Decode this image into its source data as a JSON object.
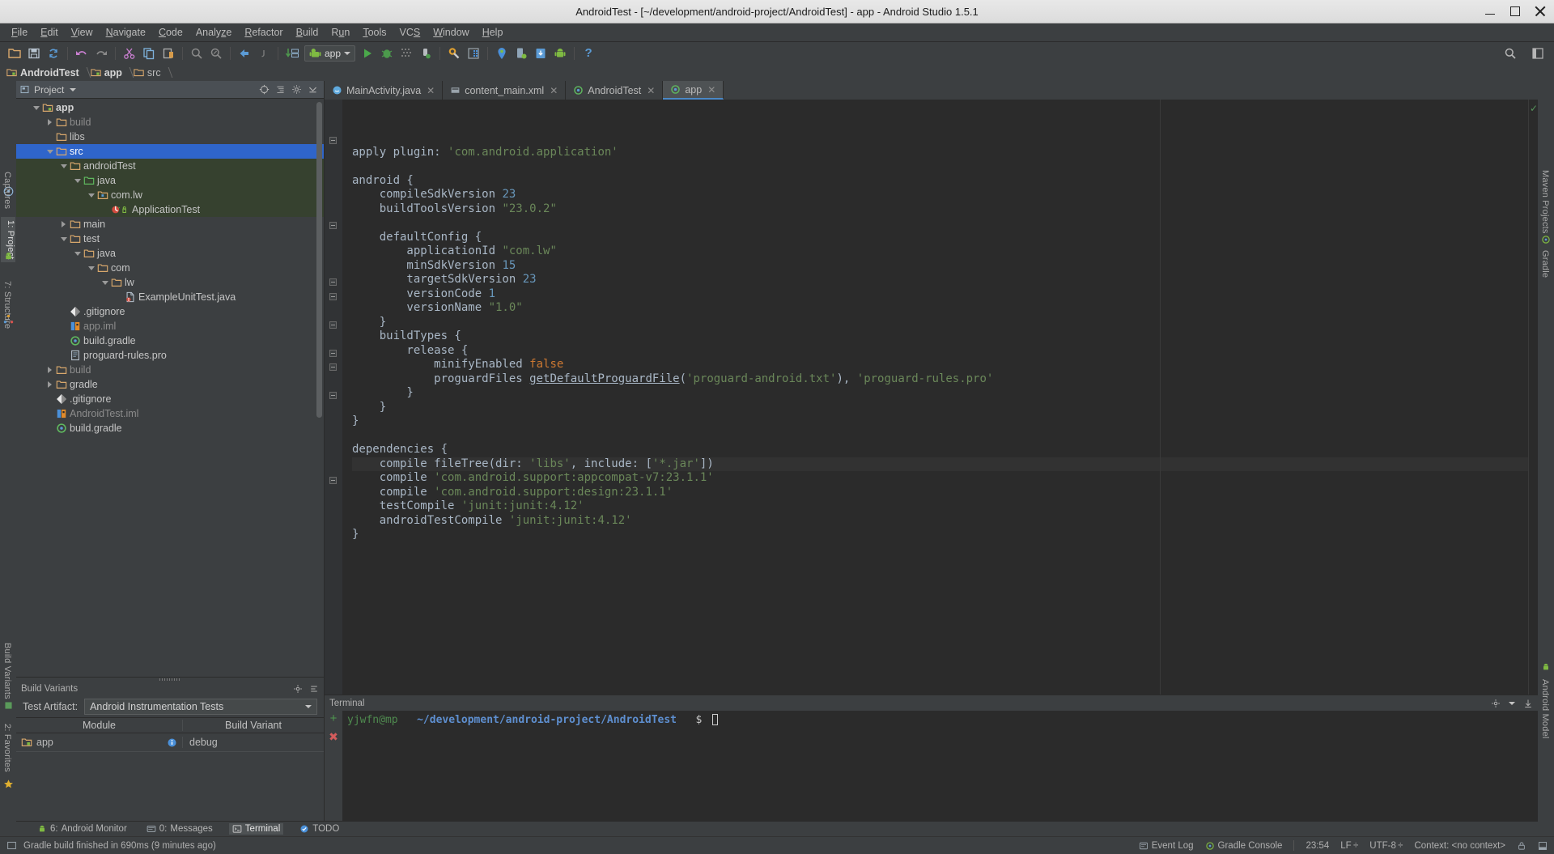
{
  "window": {
    "title": "AndroidTest - [~/development/android-project/AndroidTest] - app - Android Studio 1.5.1",
    "minimize": "minimize-window",
    "maximize": "maximize-window",
    "close": "close-window"
  },
  "menubar": [
    {
      "label": "File",
      "mnemonic": "F"
    },
    {
      "label": "Edit",
      "mnemonic": "E"
    },
    {
      "label": "View",
      "mnemonic": "V"
    },
    {
      "label": "Navigate",
      "mnemonic": "N"
    },
    {
      "label": "Code",
      "mnemonic": "C"
    },
    {
      "label": "Analyze",
      "mnemonic": "z"
    },
    {
      "label": "Refactor",
      "mnemonic": "R"
    },
    {
      "label": "Build",
      "mnemonic": "B"
    },
    {
      "label": "Run",
      "mnemonic": "R"
    },
    {
      "label": "Tools",
      "mnemonic": "T"
    },
    {
      "label": "VCS",
      "mnemonic": "S"
    },
    {
      "label": "Window",
      "mnemonic": "W"
    },
    {
      "label": "Help",
      "mnemonic": "H"
    }
  ],
  "toolbar": {
    "run_config_label": "app",
    "buttons": [
      "open-folder-icon",
      "save-all-icon",
      "sync-icon",
      "undo-icon",
      "redo-icon",
      "cut-icon",
      "copy-icon",
      "paste-icon",
      "find-icon",
      "find-usages-icon",
      "back-icon",
      "forward-icon",
      "update-project-icon"
    ],
    "right_buttons": [
      "search-everywhere-icon",
      "layout-icon"
    ]
  },
  "breadcrumb": [
    {
      "label": "AndroidTest",
      "icon": "module-icon",
      "bold": true
    },
    {
      "label": "app",
      "icon": "module-icon",
      "bold": true
    },
    {
      "label": "src",
      "icon": "folder-icon",
      "bold": false
    }
  ],
  "left_toolwindows": [
    {
      "label": "Captures",
      "icon": "captures-icon"
    },
    {
      "label": "1: Project",
      "icon": "android-icon",
      "selected": true
    },
    {
      "label": "7: Structure",
      "icon": "structure-icon"
    },
    {
      "label": "Build Variants",
      "icon": "variants-icon"
    },
    {
      "label": "2: Favorites",
      "icon": "favorites-icon"
    }
  ],
  "right_toolwindows": [
    {
      "label": "Maven Projects",
      "icon": "maven-icon"
    },
    {
      "label": "Gradle",
      "icon": "gradle-icon"
    },
    {
      "label": "Android Model",
      "icon": "android-model-icon"
    }
  ],
  "project_panel": {
    "title": "Project",
    "actions": [
      "target-icon",
      "collapse-all-icon",
      "settings-icon",
      "hide-icon"
    ],
    "tree": [
      {
        "depth": 0,
        "label": "app",
        "icon": "module",
        "twisty": "down",
        "bold": true
      },
      {
        "depth": 1,
        "label": "build",
        "icon": "folder",
        "twisty": "right",
        "dim": true
      },
      {
        "depth": 1,
        "label": "libs",
        "icon": "folder",
        "twisty": "none"
      },
      {
        "depth": 1,
        "label": "src",
        "icon": "folder",
        "twisty": "down",
        "selected": true
      },
      {
        "depth": 2,
        "label": "androidTest",
        "icon": "folder",
        "twisty": "down",
        "green": true
      },
      {
        "depth": 3,
        "label": "java",
        "icon": "folder-source",
        "twisty": "down",
        "green": true
      },
      {
        "depth": 4,
        "label": "com.lw",
        "icon": "package",
        "twisty": "down",
        "green": true
      },
      {
        "depth": 5,
        "label": "ApplicationTest",
        "icon": "class-test",
        "twisty": "none",
        "green": true
      },
      {
        "depth": 2,
        "label": "main",
        "icon": "folder",
        "twisty": "right"
      },
      {
        "depth": 2,
        "label": "test",
        "icon": "folder",
        "twisty": "down"
      },
      {
        "depth": 3,
        "label": "java",
        "icon": "folder",
        "twisty": "down"
      },
      {
        "depth": 4,
        "label": "com",
        "icon": "folder",
        "twisty": "down"
      },
      {
        "depth": 5,
        "label": "lw",
        "icon": "folder",
        "twisty": "down"
      },
      {
        "depth": 6,
        "label": "ExampleUnitTest.java",
        "icon": "java-error",
        "twisty": "none"
      },
      {
        "depth": 2,
        "label": ".gitignore",
        "icon": "git",
        "twisty": "none"
      },
      {
        "depth": 2,
        "label": "app.iml",
        "icon": "iml",
        "twisty": "none",
        "dim": true
      },
      {
        "depth": 2,
        "label": "build.gradle",
        "icon": "gradle",
        "twisty": "none"
      },
      {
        "depth": 2,
        "label": "proguard-rules.pro",
        "icon": "text",
        "twisty": "none"
      },
      {
        "depth": 1,
        "label": "build",
        "icon": "folder",
        "twisty": "right",
        "dim": true
      },
      {
        "depth": 1,
        "label": "gradle",
        "icon": "folder",
        "twisty": "right"
      },
      {
        "depth": 1,
        "label": ".gitignore",
        "icon": "git",
        "twisty": "none"
      },
      {
        "depth": 1,
        "label": "AndroidTest.iml",
        "icon": "iml",
        "twisty": "none",
        "dim": true
      },
      {
        "depth": 1,
        "label": "build.gradle",
        "icon": "gradle",
        "twisty": "none"
      }
    ]
  },
  "build_variants": {
    "title": "Build Variants",
    "test_artifact_label": "Test Artifact:",
    "test_artifact_value": "Android Instrumentation Tests",
    "columns": [
      "Module",
      "Build Variant"
    ],
    "rows": [
      {
        "module": "app",
        "variant": "debug"
      }
    ]
  },
  "editor": {
    "tabs": [
      {
        "label": "MainActivity.java",
        "icon": "java-class",
        "active": false,
        "closable": true
      },
      {
        "label": "content_main.xml",
        "icon": "xml",
        "active": false,
        "closable": true
      },
      {
        "label": "AndroidTest",
        "icon": "gradle",
        "active": false,
        "closable": true
      },
      {
        "label": "app",
        "icon": "gradle",
        "active": true,
        "closable": true
      }
    ],
    "code_lines": [
      [
        {
          "t": "apply plugin: ",
          "c": "plain"
        },
        {
          "t": "'com.android.application'",
          "c": "str"
        }
      ],
      [],
      [
        {
          "t": "android {",
          "c": "plain"
        }
      ],
      [
        {
          "t": "    compileSdkVersion ",
          "c": "plain"
        },
        {
          "t": "23",
          "c": "num"
        }
      ],
      [
        {
          "t": "    buildToolsVersion ",
          "c": "plain"
        },
        {
          "t": "\"23.0.2\"",
          "c": "str"
        }
      ],
      [],
      [
        {
          "t": "    defaultConfig {",
          "c": "plain"
        }
      ],
      [
        {
          "t": "        applicationId ",
          "c": "plain"
        },
        {
          "t": "\"com.lw\"",
          "c": "str"
        }
      ],
      [
        {
          "t": "        minSdkVersion ",
          "c": "plain"
        },
        {
          "t": "15",
          "c": "num"
        }
      ],
      [
        {
          "t": "        targetSdkVersion ",
          "c": "plain"
        },
        {
          "t": "23",
          "c": "num"
        }
      ],
      [
        {
          "t": "        versionCode ",
          "c": "plain"
        },
        {
          "t": "1",
          "c": "num"
        }
      ],
      [
        {
          "t": "        versionName ",
          "c": "plain"
        },
        {
          "t": "\"1.0\"",
          "c": "str"
        }
      ],
      [
        {
          "t": "    }",
          "c": "plain"
        }
      ],
      [
        {
          "t": "    buildTypes {",
          "c": "plain"
        }
      ],
      [
        {
          "t": "        release {",
          "c": "plain"
        }
      ],
      [
        {
          "t": "            minifyEnabled ",
          "c": "plain"
        },
        {
          "t": "false",
          "c": "kw"
        }
      ],
      [
        {
          "t": "            proguardFiles ",
          "c": "plain"
        },
        {
          "t": "getDefaultProguardFile",
          "c": "plain-ul"
        },
        {
          "t": "(",
          "c": "plain"
        },
        {
          "t": "'proguard-android.txt'",
          "c": "str"
        },
        {
          "t": "), ",
          "c": "plain"
        },
        {
          "t": "'proguard-rules.pro'",
          "c": "str"
        }
      ],
      [
        {
          "t": "        }",
          "c": "plain"
        }
      ],
      [
        {
          "t": "    }",
          "c": "plain"
        }
      ],
      [
        {
          "t": "}",
          "c": "plain"
        }
      ],
      [],
      [
        {
          "t": "dependencies {",
          "c": "plain"
        }
      ],
      [
        {
          "t": "    compile fileTree(dir: ",
          "c": "plain"
        },
        {
          "t": "'libs'",
          "c": "str"
        },
        {
          "t": ", include: [",
          "c": "plain"
        },
        {
          "t": "'*.jar'",
          "c": "str"
        },
        {
          "t": "])",
          "c": "plain"
        }
      ],
      [
        {
          "t": "    compile ",
          "c": "plain"
        },
        {
          "t": "'com.android.support:appcompat-v7:23.1.1'",
          "c": "str"
        }
      ],
      [
        {
          "t": "    compile ",
          "c": "plain"
        },
        {
          "t": "'com.android.support:design:23.1.1'",
          "c": "str"
        }
      ],
      [
        {
          "t": "    testCompile ",
          "c": "plain"
        },
        {
          "t": "'junit:junit:4.12'",
          "c": "str"
        }
      ],
      [
        {
          "t": "    androidTestCompile ",
          "c": "plain"
        },
        {
          "t": "'junit:junit:4.12'",
          "c": "str"
        }
      ],
      [
        {
          "t": "}",
          "c": "plain"
        }
      ]
    ]
  },
  "terminal": {
    "title": "Terminal",
    "user": "yjwfn@mp",
    "path": "~/development/android-project/AndroidTest",
    "prompt": "$",
    "add_label": "new-session",
    "close_label": "close-session"
  },
  "bottom_tabs": [
    {
      "num": "6:",
      "label": "Android Monitor",
      "icon": "android-icon",
      "selected": false
    },
    {
      "num": "0:",
      "label": "Messages",
      "icon": "messages-icon",
      "selected": false
    },
    {
      "num": "",
      "label": "Terminal",
      "icon": "terminal-icon",
      "selected": true
    },
    {
      "num": "",
      "label": "TODO",
      "icon": "todo-icon",
      "selected": false
    }
  ],
  "statusbar": {
    "message": "Gradle build finished in 690ms (9 minutes ago)",
    "time": "23:54",
    "line_sep": "LF ÷",
    "encoding": "UTF-8 ÷",
    "context": "Context: <no context>",
    "event_log": "Event Log",
    "gradle_console": "Gradle Console",
    "lock_icon": "lock-icon",
    "hide_icon": "hide-icon"
  },
  "colors": {
    "accent": "#2f65ca",
    "panel": "#3c3f41",
    "editor_bg": "#2b2b2b",
    "string": "#6a8759",
    "number": "#6897bb",
    "keyword": "#cc7832",
    "text": "#a9b7c6"
  }
}
